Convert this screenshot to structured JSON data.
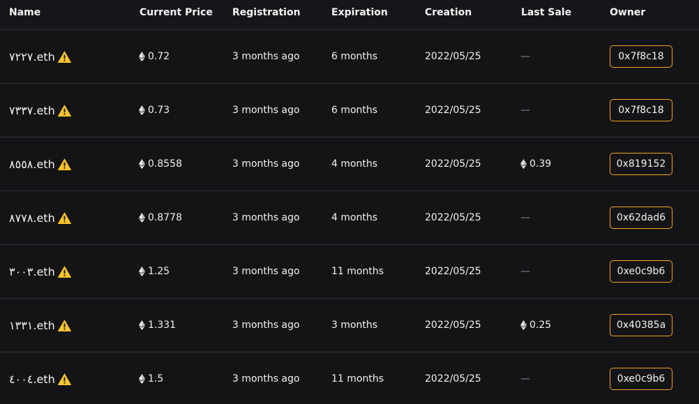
{
  "columns": {
    "name": "Name",
    "current_price": "Current Price",
    "registration": "Registration",
    "expiration": "Expiration",
    "creation": "Creation",
    "last_sale": "Last Sale",
    "owner": "Owner"
  },
  "icons": {
    "currency": "ethereum-icon",
    "name_flag": "warning-icon"
  },
  "colors": {
    "background": "#141416",
    "owner_border": "#f5a524",
    "warning": "#f7c430"
  },
  "rows": [
    {
      "name": "٧٢٢٧.eth",
      "price": "0.72",
      "registration": "3 months ago",
      "expiration": "6 months",
      "creation": "2022/05/25",
      "last_sale": "—",
      "owner": "0x7f8c18"
    },
    {
      "name": "٧٣٣٧.eth",
      "price": "0.73",
      "registration": "3 months ago",
      "expiration": "6 months",
      "creation": "2022/05/25",
      "last_sale": "—",
      "owner": "0x7f8c18"
    },
    {
      "name": "٨٥٥٨.eth",
      "price": "0.8558",
      "registration": "3 months ago",
      "expiration": "4 months",
      "creation": "2022/05/25",
      "last_sale": "0.39",
      "owner": "0x819152"
    },
    {
      "name": "٨٧٧٨.eth",
      "price": "0.8778",
      "registration": "3 months ago",
      "expiration": "4 months",
      "creation": "2022/05/25",
      "last_sale": "—",
      "owner": "0x62dad6"
    },
    {
      "name": "٣٠٠٣.eth",
      "price": "1.25",
      "registration": "3 months ago",
      "expiration": "11 months",
      "creation": "2022/05/25",
      "last_sale": "—",
      "owner": "0xe0c9b6"
    },
    {
      "name": "١٣٣١.eth",
      "price": "1.331",
      "registration": "3 months ago",
      "expiration": "3 months",
      "creation": "2022/05/25",
      "last_sale": "0.25",
      "owner": "0x40385a"
    },
    {
      "name": "٤٠٠٤.eth",
      "price": "1.5",
      "registration": "3 months ago",
      "expiration": "11 months",
      "creation": "2022/05/25",
      "last_sale": "—",
      "owner": "0xe0c9b6"
    }
  ]
}
